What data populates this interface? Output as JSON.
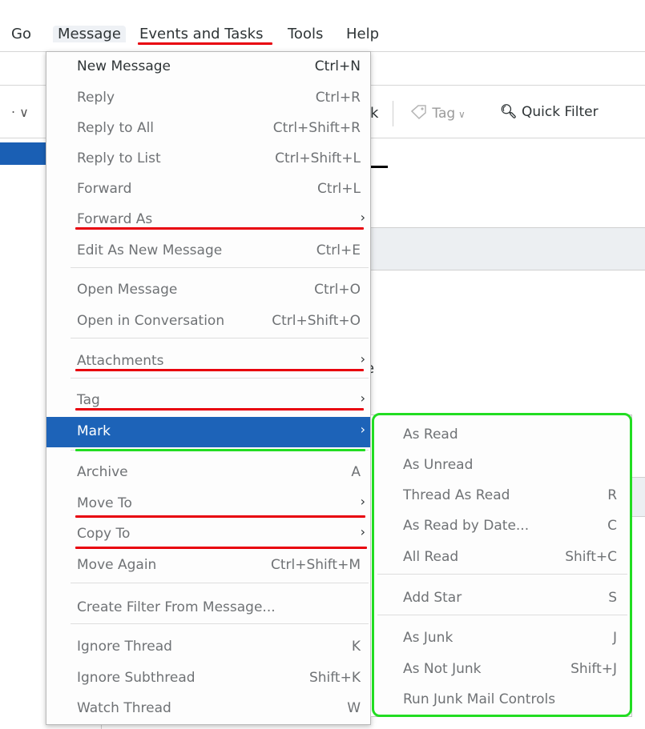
{
  "menubar": {
    "items": [
      "Go",
      "Message",
      "Events and Tasks",
      "Tools",
      "Help"
    ]
  },
  "background": {
    "toolbar_fragment": "‧ ∨",
    "fragment_k": "k",
    "fragment_e": "e",
    "tag_label": "Tag",
    "quick_filter_label": "Quick Filter"
  },
  "menu": {
    "items": [
      {
        "label": "New Message",
        "accel": "Ctrl+N"
      },
      {
        "label": "Reply",
        "accel": "Ctrl+R"
      },
      {
        "label": "Reply to All",
        "accel": "Ctrl+Shift+R"
      },
      {
        "label": "Reply to List",
        "accel": "Ctrl+Shift+L"
      },
      {
        "label": "Forward",
        "accel": "Ctrl+L"
      },
      {
        "label": "Forward As",
        "accel": ""
      },
      {
        "label": "Edit As New Message",
        "accel": "Ctrl+E"
      },
      {
        "label": "Open Message",
        "accel": "Ctrl+O"
      },
      {
        "label": "Open in Conversation",
        "accel": "Ctrl+Shift+O"
      },
      {
        "label": "Attachments",
        "accel": ""
      },
      {
        "label": "Tag",
        "accel": ""
      },
      {
        "label": "Mark",
        "accel": ""
      },
      {
        "label": "Archive",
        "accel": "A"
      },
      {
        "label": "Move To",
        "accel": ""
      },
      {
        "label": "Copy To",
        "accel": ""
      },
      {
        "label": "Move Again",
        "accel": "Ctrl+Shift+M"
      },
      {
        "label": "Create Filter From Message...",
        "accel": ""
      },
      {
        "label": "Ignore Thread",
        "accel": "K"
      },
      {
        "label": "Ignore Subthread",
        "accel": "Shift+K"
      },
      {
        "label": "Watch Thread",
        "accel": "W"
      }
    ],
    "submenu_arrow": "›"
  },
  "submenu": {
    "items": [
      {
        "label": "As Read",
        "accel": ""
      },
      {
        "label": "As Unread",
        "accel": ""
      },
      {
        "label": "Thread As Read",
        "accel": "R"
      },
      {
        "label": "As Read by Date...",
        "accel": "C"
      },
      {
        "label": "All Read",
        "accel": "Shift+C"
      },
      {
        "label": "Add Star",
        "accel": "S"
      },
      {
        "label": "As Junk",
        "accel": "J"
      },
      {
        "label": "As Not Junk",
        "accel": "Shift+J"
      },
      {
        "label": "Run Junk Mail Controls",
        "accel": ""
      }
    ]
  },
  "colors": {
    "highlight": "#1d63b8",
    "annotation_red": "#e8000d",
    "annotation_green": "#22dd22"
  }
}
